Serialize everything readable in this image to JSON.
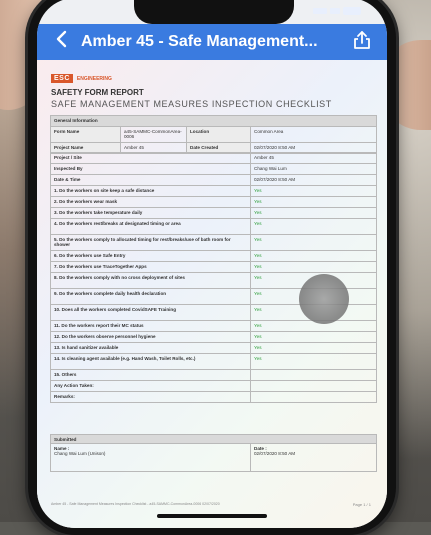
{
  "app": {
    "title": "Amber 45 - Safe Management...",
    "accent": "#3a7be0"
  },
  "doc": {
    "logo_text": "ESC",
    "logo_sub": "ENGINEERING",
    "report_title": "SAFETY FORM REPORT",
    "checklist_title": "SAFE MANAGEMENT MEASURES INSPECTION CHECKLIST",
    "general_info_label": "General Information",
    "form_name_label": "Form Name",
    "form_name_value": "a45-SAMMC-CommonArea-0006",
    "location_label": "Location",
    "location_value": "Common Area",
    "project_name_label": "Project Name",
    "project_name_value": "Amber 45",
    "date_created_label": "Date Created",
    "date_created_value": "02/07/2020 8:50 AM",
    "rows": [
      {
        "q": "Project / Site",
        "a": "Amber 45"
      },
      {
        "q": "Inspected By",
        "a": "Chang Wai Lum"
      },
      {
        "q": "Date & Time",
        "a": "02/07/2020 8:50 AM"
      },
      {
        "q": "1. Do the workers on site keep a safe distance",
        "a": "Yes"
      },
      {
        "q": "2. Do the workers wear mask",
        "a": "Yes"
      },
      {
        "q": "3. Do the workers take temperature daily",
        "a": "Yes"
      },
      {
        "q": "4. Do the workers rest/breaks at designated timing or area",
        "a": "Yes"
      },
      {
        "q": "5. Do the workers comply to allocated timing for rest/breaks/use of bath room for shower",
        "a": "Yes"
      },
      {
        "q": "6. Do the workers use Safe Entry",
        "a": "Yes"
      },
      {
        "q": "7. Do the workers use TraceTogether Apps",
        "a": "Yes"
      },
      {
        "q": "8. Do the workers comply with no cross deployment of sites",
        "a": "Yes"
      },
      {
        "q": "9. Do the workers complete daily health declaration",
        "a": "Yes"
      },
      {
        "q": "10. Does all the workers completed CovidSAFE Training",
        "a": "Yes"
      },
      {
        "q": "11. Do the workers report their MC status",
        "a": "Yes"
      },
      {
        "q": "12. Do the workers observe personnel hygiene",
        "a": "Yes"
      },
      {
        "q": "13. Is hand sanitizer available",
        "a": "Yes"
      },
      {
        "q": "14. Is cleaning agent available (e.g. Hand Wash, Toilet Rolls, etc.)",
        "a": "Yes"
      },
      {
        "q": "15. Others",
        "a": ""
      },
      {
        "q": "Any Action Taken:",
        "a": ""
      },
      {
        "q": "Remarks:",
        "a": ""
      }
    ],
    "submitted": {
      "heading": "Submitted",
      "name_label": "Name :",
      "name_value": "Chang Wai Lum (Unison)",
      "date_label": "Date :",
      "date_value": "02/07/2020 8:50 AM"
    },
    "footer_left": "Amber 45 - Safe Management Measures Inspection Checklist - a45-SAMMC-CommonArea-0006 02/07/2020",
    "footer_right": "Page 1 / 1"
  }
}
